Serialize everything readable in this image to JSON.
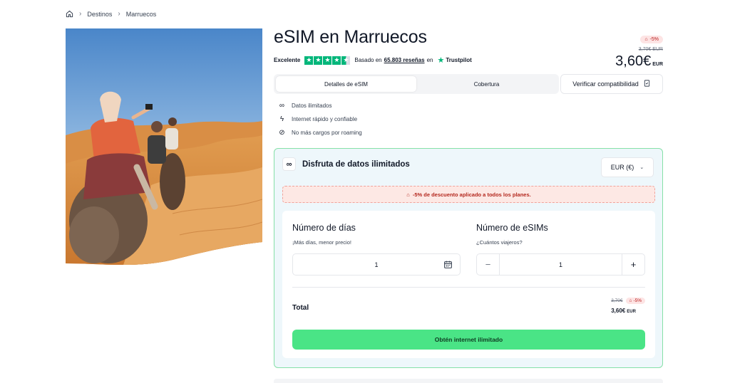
{
  "breadcrumb": {
    "items": [
      "Destinos",
      "Marruecos"
    ]
  },
  "product": {
    "title": "eSIM en Marruecos"
  },
  "rating": {
    "label": "Excelente",
    "stars": 4.5,
    "based_on": "Basado en",
    "reviews": "65.803 reseñas",
    "on": "en",
    "provider": "Trustpilot"
  },
  "price": {
    "discount_badge": "-5%",
    "old": "3,70€ EUR",
    "new": "3,60€",
    "currency": "EUR"
  },
  "tabs": [
    {
      "label": "Detalles de eSIM",
      "active": true
    },
    {
      "label": "Cobertura",
      "active": false
    }
  ],
  "verify_button": "Verificar compatibilidad",
  "features": [
    {
      "icon": "infinity-icon",
      "label": "Datos ilimitados"
    },
    {
      "icon": "lightning-icon",
      "label": "Internet rápido y confiable"
    },
    {
      "icon": "no-roaming-icon",
      "label": "No más cargos por roaming"
    }
  ],
  "plan_card": {
    "title": "Disfruta de datos ilimitados",
    "currency_select": "EUR (€)",
    "promo": "-5% de descuento aplicado a todos los planes.",
    "days": {
      "title": "Número de días",
      "subtitle": "¡Más días, menor precio!",
      "value": "1"
    },
    "esims": {
      "title": "Número de eSIMs",
      "subtitle": "¿Cuántos viajeros?",
      "value": "1"
    },
    "total": {
      "label": "Total",
      "old": "3,70€",
      "badge": "-5%",
      "final": "3,60€",
      "currency": "EUR"
    },
    "cta": "Obtén internet ilimitado"
  },
  "colors": {
    "accent_green": "#4ae486",
    "card_border": "#86e0a8",
    "card_bg": "#eef7fb",
    "trustpilot": "#00b67a",
    "discount_red": "#b91c1c"
  }
}
